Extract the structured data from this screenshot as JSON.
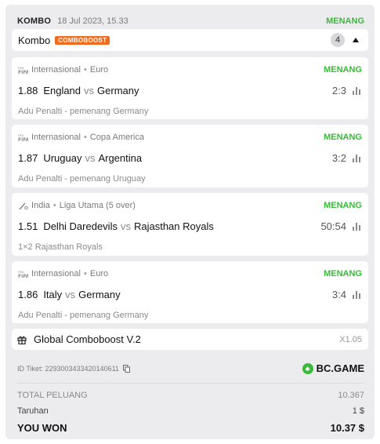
{
  "header": {
    "type": "KOMBO",
    "date": "18 Jul 2023, 15.33",
    "status": "MENANG"
  },
  "combo": {
    "label": "Kombo",
    "boost_tag": "COMBOBOOST",
    "count": "4"
  },
  "bets": [
    {
      "icon": "fifa-icon",
      "region": "Internasional",
      "competition": "Euro",
      "status": "MENANG",
      "odds": "1.88",
      "home": "England",
      "vs": "vs",
      "away": "Germany",
      "score": "2:3",
      "market": "Adu Penalti - pemenang Germany"
    },
    {
      "icon": "fifa-icon",
      "region": "Internasional",
      "competition": "Copa America",
      "status": "MENANG",
      "odds": "1.87",
      "home": "Uruguay",
      "vs": "vs",
      "away": "Argentina",
      "score": "3:2",
      "market": "Adu Penalti - pemenang Uruguay"
    },
    {
      "icon": "cricket-icon",
      "region": "India",
      "competition": "Liga Utama (5 over)",
      "status": "MENANG",
      "odds": "1.51",
      "home": "Delhi Daredevils",
      "vs": "vs",
      "away": "Rajasthan Royals",
      "score": "50:54",
      "market": "1×2 Rajasthan Royals"
    },
    {
      "icon": "fifa-icon",
      "region": "Internasional",
      "competition": "Euro",
      "status": "MENANG",
      "odds": "1.86",
      "home": "Italy",
      "vs": "vs",
      "away": "Germany",
      "score": "3:4",
      "market": "Adu Penalti - pemenang Germany"
    }
  ],
  "boost": {
    "name": "Global Comboboost V.2",
    "multiplier": "X1.05"
  },
  "ticket": {
    "id_text": "ID Tiket: 2293003433420140611",
    "brand": "BC.GAME"
  },
  "summary": {
    "total_label": "TOTAL PELUANG",
    "total_value": "10.367",
    "stake_label": "Taruhan",
    "stake_value": "1 $",
    "won_label": "YOU WON",
    "won_value": "10.37 $"
  },
  "colors": {
    "win": "#3aba3a",
    "boost_tag": "#f26a1b",
    "card_bg": "#ececee"
  }
}
